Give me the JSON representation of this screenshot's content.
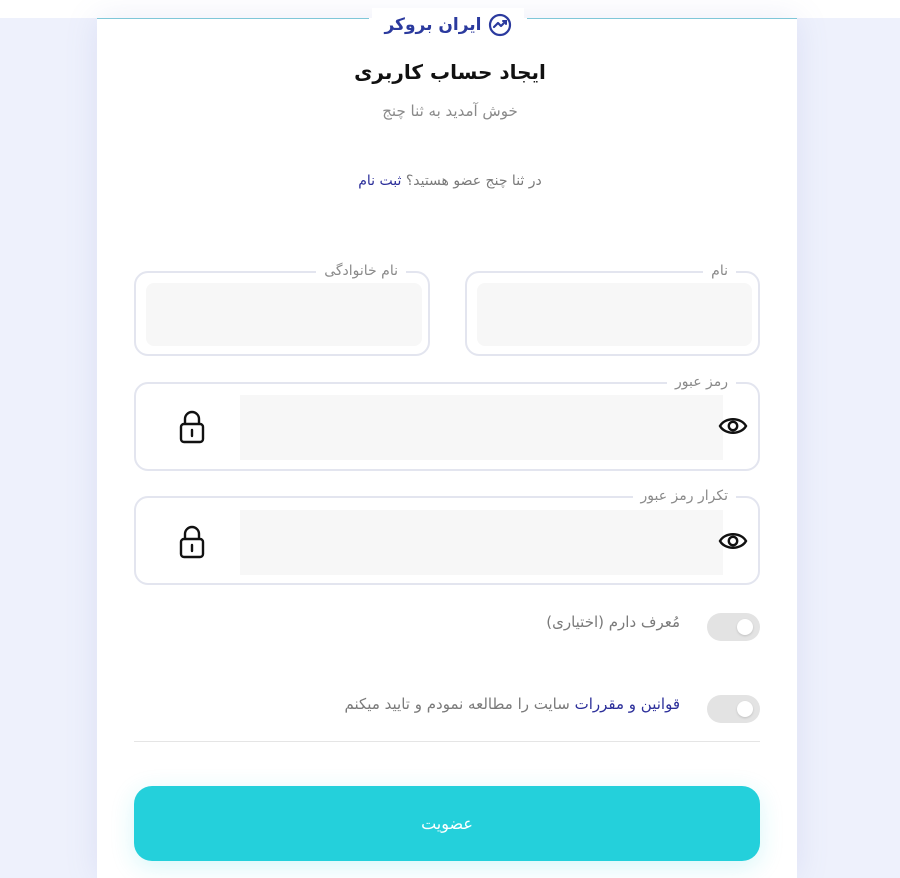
{
  "brand": {
    "logo_text": "ایران بروکر",
    "logo_icon": "chart-trend-icon"
  },
  "header": {
    "title": "ایجاد حساب کاربری",
    "subtitle": "خوش آمدید به ثنا چنج"
  },
  "member_prompt": {
    "text": "در ثنا چنج عضو هستید؟",
    "link": "ثبت نام"
  },
  "form": {
    "first_name": {
      "label": "نام",
      "value": ""
    },
    "last_name": {
      "label": "نام خانوادگی",
      "value": ""
    },
    "password": {
      "label": "رمز عبور",
      "value": ""
    },
    "password_confirm": {
      "label": "تکرار رمز عبور",
      "value": ""
    },
    "referrer_toggle": {
      "label": "مُعرف دارم (اختیاری)",
      "on": false
    },
    "terms_toggle": {
      "link": "قوانین و مقررات",
      "text": " سایت را مطالعه نمودم و تایید میکنم",
      "on": false
    },
    "submit_label": "عضویت"
  },
  "colors": {
    "accent": "#24d0db",
    "link": "#2c2f9a",
    "background": "#eef1fc"
  }
}
